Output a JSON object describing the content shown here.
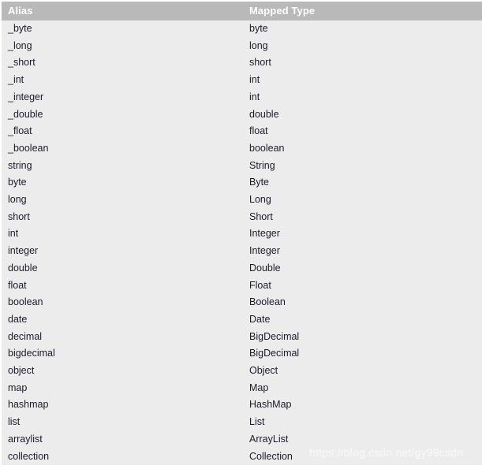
{
  "table": {
    "name": "alias-to-mapped-type-table",
    "columns": [
      {
        "key": "alias",
        "label": "Alias"
      },
      {
        "key": "mapped",
        "label": "Mapped Type"
      }
    ],
    "rows": [
      {
        "alias": "_byte",
        "mapped": "byte"
      },
      {
        "alias": "_long",
        "mapped": "long"
      },
      {
        "alias": "_short",
        "mapped": "short"
      },
      {
        "alias": "_int",
        "mapped": "int"
      },
      {
        "alias": "_integer",
        "mapped": "int"
      },
      {
        "alias": "_double",
        "mapped": "double"
      },
      {
        "alias": "_float",
        "mapped": "float"
      },
      {
        "alias": "_boolean",
        "mapped": "boolean"
      },
      {
        "alias": "string",
        "mapped": "String"
      },
      {
        "alias": "byte",
        "mapped": "Byte"
      },
      {
        "alias": "long",
        "mapped": "Long"
      },
      {
        "alias": "short",
        "mapped": "Short"
      },
      {
        "alias": "int",
        "mapped": "Integer"
      },
      {
        "alias": "integer",
        "mapped": "Integer"
      },
      {
        "alias": "double",
        "mapped": "Double"
      },
      {
        "alias": "float",
        "mapped": "Float"
      },
      {
        "alias": "boolean",
        "mapped": "Boolean"
      },
      {
        "alias": "date",
        "mapped": "Date"
      },
      {
        "alias": "decimal",
        "mapped": "BigDecimal"
      },
      {
        "alias": "bigdecimal",
        "mapped": "BigDecimal"
      },
      {
        "alias": "object",
        "mapped": "Object"
      },
      {
        "alias": "map",
        "mapped": "Map"
      },
      {
        "alias": "hashmap",
        "mapped": "HashMap"
      },
      {
        "alias": "list",
        "mapped": "List"
      },
      {
        "alias": "arraylist",
        "mapped": "ArrayList"
      },
      {
        "alias": "collection",
        "mapped": "Collection"
      }
    ]
  },
  "watermark": {
    "text": "https://blog.csdn.net/gy99csdn"
  },
  "colors": {
    "header_background": "#b9b9b9",
    "header_text": "#ffffff",
    "row_background": "#ececec",
    "row_text": "#1b1b2b",
    "page_background": "#ffffff",
    "watermark_text": "#f6f6f6"
  }
}
